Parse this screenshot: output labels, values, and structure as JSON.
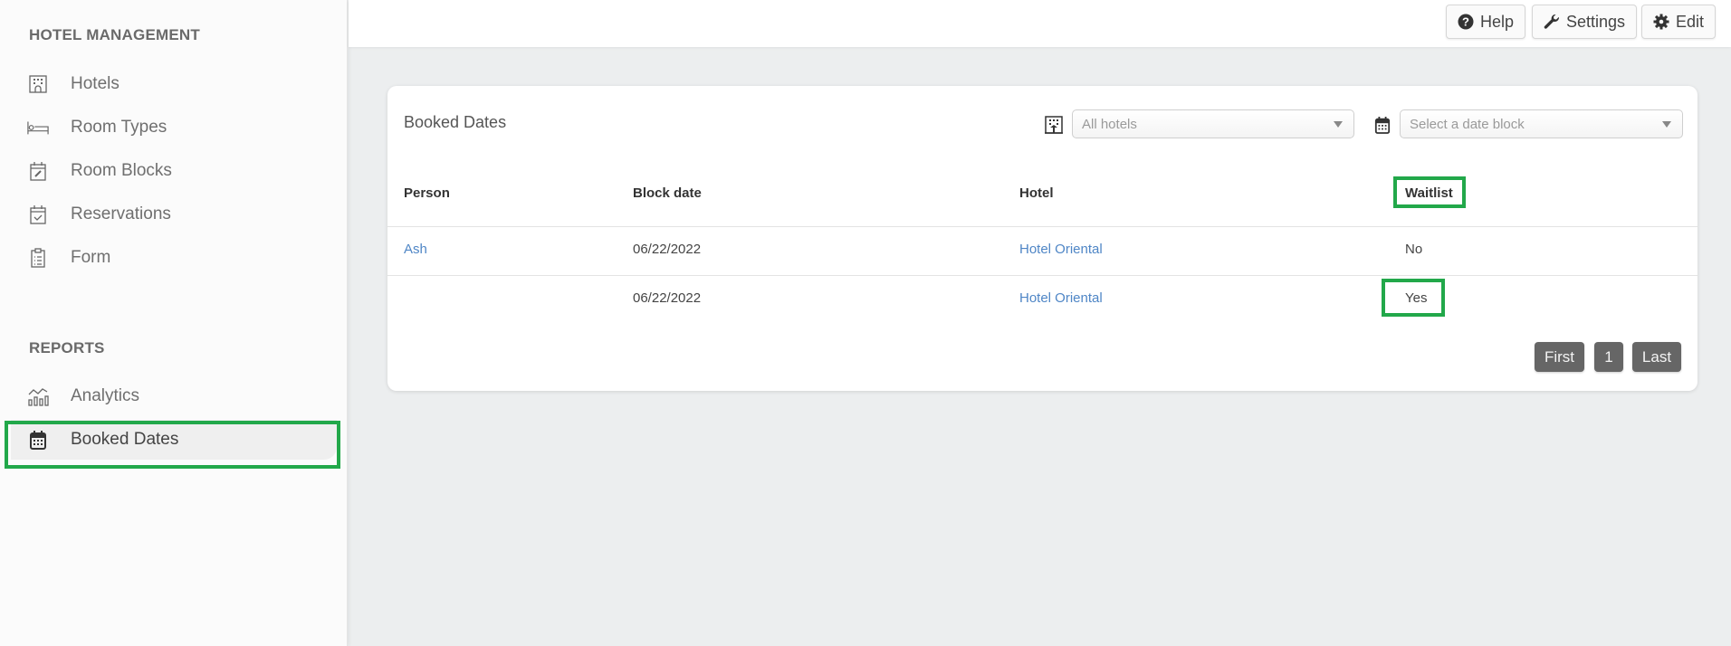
{
  "sidebar": {
    "sections": [
      {
        "title": "HOTEL MANAGEMENT",
        "items": [
          {
            "label": "Hotels",
            "icon": "hotel-icon"
          },
          {
            "label": "Room Types",
            "icon": "bed-icon"
          },
          {
            "label": "Room Blocks",
            "icon": "calendar-edit-icon"
          },
          {
            "label": "Reservations",
            "icon": "calendar-check-icon"
          },
          {
            "label": "Form",
            "icon": "clipboard-icon"
          }
        ]
      },
      {
        "title": "REPORTS",
        "items": [
          {
            "label": "Analytics",
            "icon": "analytics-icon"
          },
          {
            "label": "Booked Dates",
            "icon": "calendar-icon",
            "active": true
          }
        ]
      }
    ]
  },
  "topbar": {
    "help_label": "Help",
    "settings_label": "Settings",
    "edit_label": "Edit"
  },
  "card": {
    "title": "Booked Dates",
    "hotel_filter": {
      "value": "All hotels",
      "icon": "hotel-icon"
    },
    "date_filter": {
      "placeholder": "Select a date block",
      "icon": "calendar-icon"
    },
    "columns": [
      "Person",
      "Block date",
      "Hotel",
      "Waitlist"
    ],
    "rows": [
      {
        "person": "Ash",
        "block_date": "06/22/2022",
        "hotel": "Hotel Oriental",
        "waitlist": "No"
      },
      {
        "person": "",
        "block_date": "06/22/2022",
        "hotel": "Hotel Oriental",
        "waitlist": "Yes"
      }
    ],
    "pagination": {
      "first": "First",
      "page": "1",
      "last": "Last"
    }
  },
  "colors": {
    "highlight": "#22a84a",
    "link": "#4f86c6",
    "pagination_bg": "#666666"
  }
}
